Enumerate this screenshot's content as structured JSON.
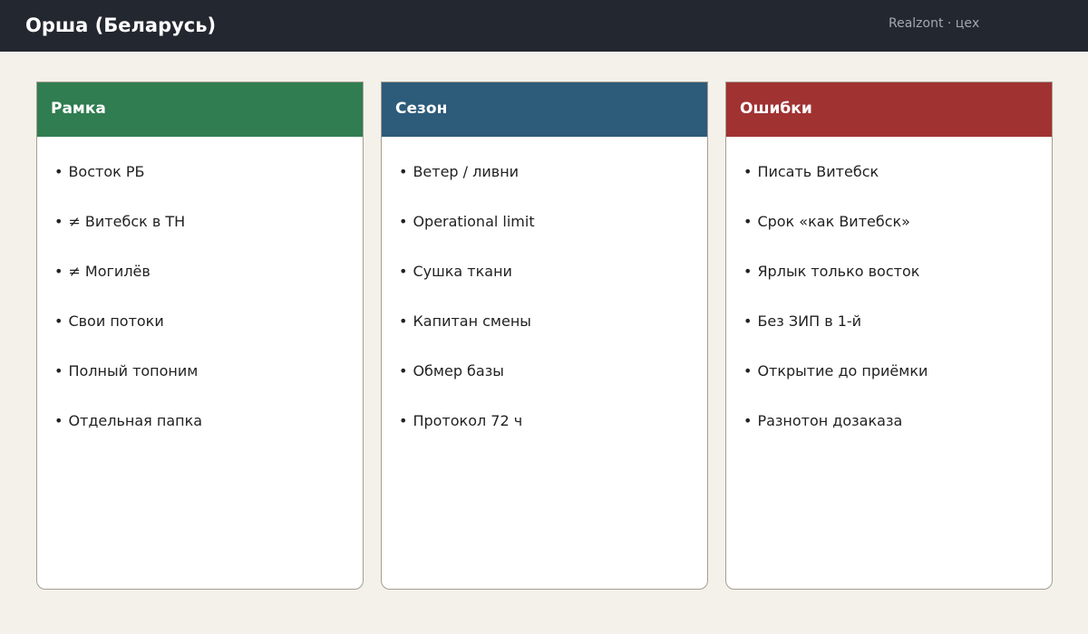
{
  "header": {
    "title": "Орша (Беларусь)",
    "brand": "Realzont · цех",
    "background": "#23272f"
  },
  "columns": [
    {
      "title": "Рамка",
      "color": "#2f7d50",
      "items": [
        "Восток РБ",
        "≠ Витебск в ТН",
        "≠ Могилёв",
        "Свои потоки",
        "Полный топоним",
        "Отдельная папка"
      ]
    },
    {
      "title": "Сезон",
      "color": "#2d5b7a",
      "items": [
        "Ветер / ливни",
        "Operational limit",
        "Сушка ткани",
        "Капитан смены",
        "Обмер базы",
        "Протокол 72 ч"
      ]
    },
    {
      "title": "Ошибки",
      "color": "#a03232",
      "items": [
        "Писать Витебск",
        "Срок «как Витебск»",
        "Ярлык только восток",
        "Без ЗИП в 1-й",
        "Открытие до приёмки",
        "Разнотон дозаказа"
      ]
    }
  ]
}
